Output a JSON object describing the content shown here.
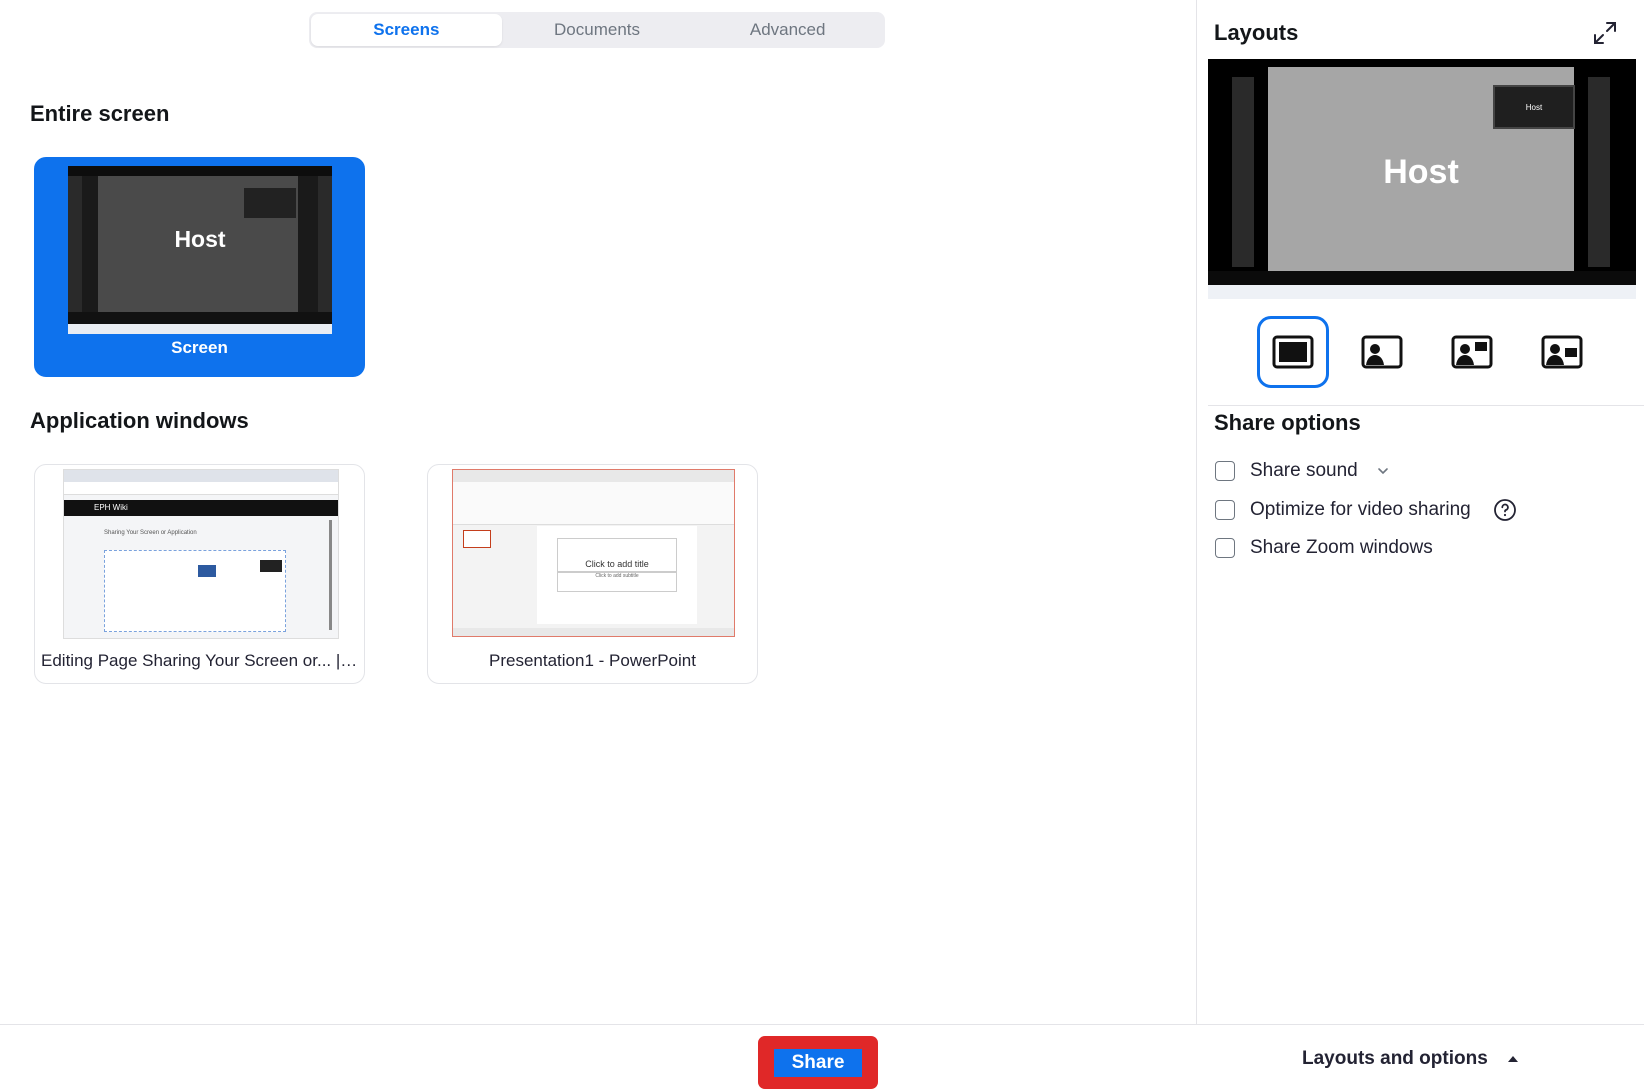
{
  "tabs": [
    {
      "label": "Screens",
      "active": true
    },
    {
      "label": "Documents",
      "active": false
    },
    {
      "label": "Advanced",
      "active": false
    }
  ],
  "sections": {
    "entire_screen": "Entire screen",
    "application_windows": "Application windows"
  },
  "screen_card": {
    "label": "Screen",
    "thumbnail_text": "Host"
  },
  "app_windows": [
    {
      "label": "Editing Page Sharing Your Screen or... | ...",
      "preview_title": "EPH Wiki",
      "preview_heading": "Sharing Your Screen or Application"
    },
    {
      "label": "Presentation1 - PowerPoint",
      "preview_title": "Click to add title",
      "preview_subtitle": "Click to add subtitle"
    }
  ],
  "right_panel": {
    "layouts_title": "Layouts",
    "preview_host": "Host",
    "preview_pip": "Host",
    "share_options_title": "Share options",
    "options": [
      {
        "label": "Share sound",
        "checked": false,
        "has_dropdown": true
      },
      {
        "label": "Optimize for video sharing",
        "checked": false,
        "has_help": true
      },
      {
        "label": "Share Zoom windows",
        "checked": false
      }
    ],
    "layout_icons": [
      "full-screen-layout-icon",
      "side-video-layout-icon",
      "video-top-right-layout-icon",
      "video-right-layout-icon"
    ]
  },
  "bottom": {
    "share_label": "Share",
    "layouts_toggle": "Layouts and options"
  },
  "colors": {
    "accent": "#0e72ed",
    "highlight": "#e02828"
  }
}
